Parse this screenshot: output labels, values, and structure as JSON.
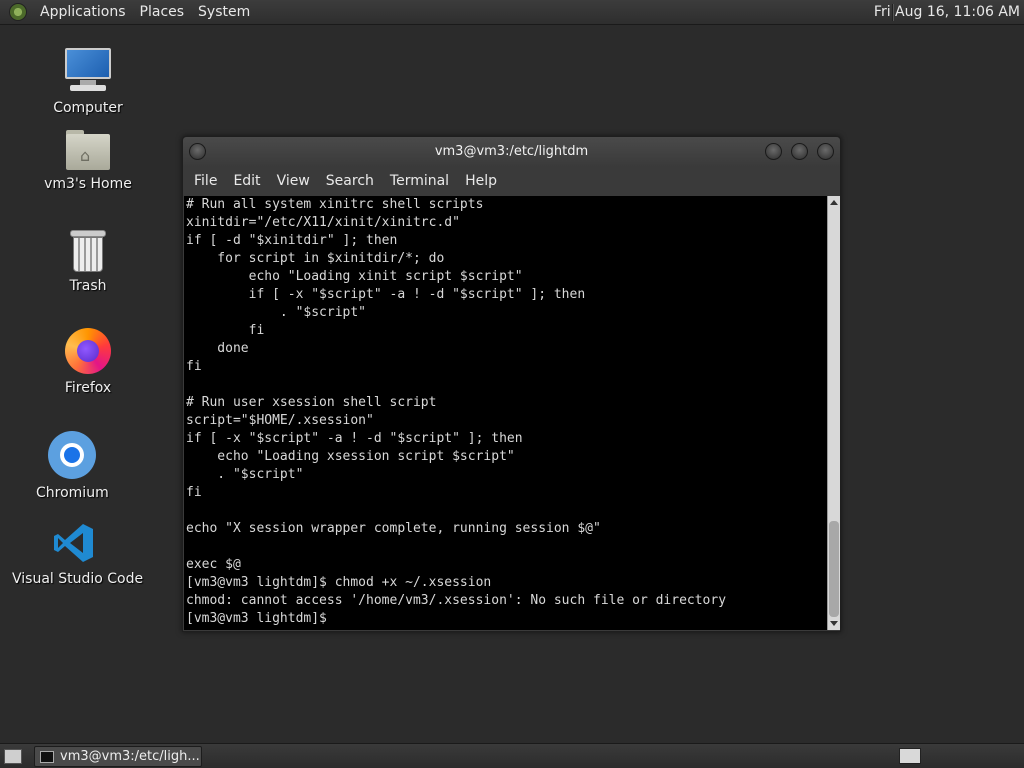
{
  "top_panel": {
    "menus": [
      "Applications",
      "Places",
      "System"
    ],
    "clock": "Fri Aug 16, 11:06 AM"
  },
  "desktop_icons": [
    {
      "label": "Computer",
      "icon": "computer-icon"
    },
    {
      "label": "vm3's Home",
      "icon": "home-folder-icon"
    },
    {
      "label": "Trash",
      "icon": "trash-icon"
    },
    {
      "label": "Firefox",
      "icon": "firefox-icon"
    },
    {
      "label": "Chromium",
      "icon": "chromium-icon"
    },
    {
      "label": "Visual Studio Code",
      "icon": "vscode-icon"
    }
  ],
  "terminal": {
    "title": "vm3@vm3:/etc/lightdm",
    "menus": [
      "File",
      "Edit",
      "View",
      "Search",
      "Terminal",
      "Help"
    ],
    "lines": [
      "# Run all system xinitrc shell scripts",
      "xinitdir=\"/etc/X11/xinit/xinitrc.d\"",
      "if [ -d \"$xinitdir\" ]; then",
      "    for script in $xinitdir/*; do",
      "        echo \"Loading xinit script $script\"",
      "        if [ -x \"$script\" -a ! -d \"$script\" ]; then",
      "            . \"$script\"",
      "        fi",
      "    done",
      "fi",
      "",
      "# Run user xsession shell script",
      "script=\"$HOME/.xsession\"",
      "if [ -x \"$script\" -a ! -d \"$script\" ]; then",
      "    echo \"Loading xsession script $script\"",
      "    . \"$script\"",
      "fi",
      "",
      "echo \"X session wrapper complete, running session $@\"",
      "",
      "exec $@",
      "[vm3@vm3 lightdm]$ chmod +x ~/.xsession",
      "chmod: cannot access '/home/vm3/.xsession': No such file or directory",
      "[vm3@vm3 lightdm]$ "
    ]
  },
  "taskbar": {
    "task_label": "vm3@vm3:/etc/ligh..."
  },
  "colors": {
    "terminal_bg": "#000000",
    "terminal_fg": "#d8d8d8",
    "panel_bg": "#333333",
    "desktop_bg": "#2b2b2b"
  }
}
